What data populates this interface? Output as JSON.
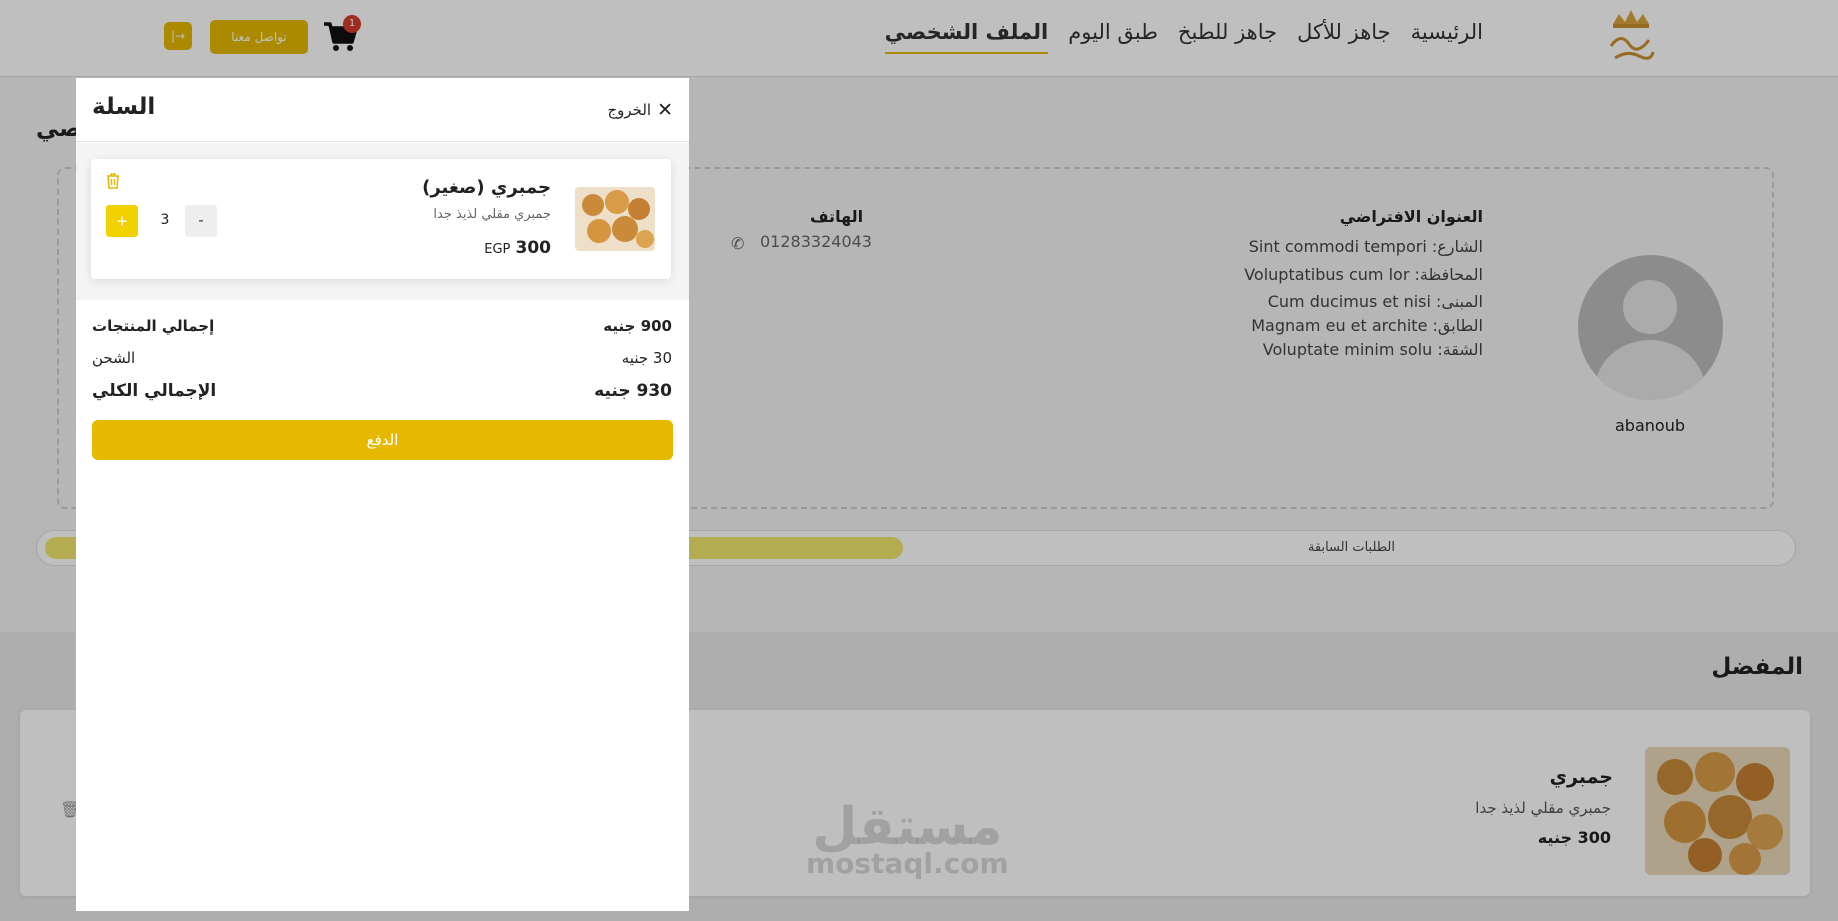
{
  "nav": {
    "links": [
      "الرئيسية",
      "جاهز للأكل",
      "جاهز للطبخ",
      "طبق اليوم",
      "الملف الشخصي"
    ],
    "cart_count": "1",
    "contact_label": "تواصل معنا",
    "login_glyph": "|→"
  },
  "profile": {
    "title": "الملف الشخصي",
    "username": "abanoub",
    "address_title": "العنوان الافتراضي",
    "street": "الشارع: Sint commodi tempori",
    "governorate": "المحافظة: Voluptatibus cum lor",
    "building": "المبنى: Cum ducimus et nisi",
    "floor": "الطابق: Magnam eu et archite",
    "apartment": "الشقة: Voluptate minim solu",
    "phone_title": "الهاتف",
    "phone_value": "01283324043",
    "orders_tab": "الطلبات السابقة"
  },
  "favorites": {
    "title": "المفضل",
    "item": {
      "name": "جمبري",
      "description": "جمبري مقلي لذيذ جدا",
      "price": "300 جنيه"
    }
  },
  "watermark": {
    "ar": "مستقل",
    "en": "mostaql.com"
  },
  "cart": {
    "title": "السلة",
    "close_label": "الخروج",
    "item": {
      "name": "جمبري (صغير)",
      "description": "جمبري مقلي لذيذ جدا",
      "price_value": "300",
      "currency": "EGP",
      "quantity": "3",
      "plus": "+",
      "minus": "-"
    },
    "subtotal_label": "إجمالي المنتجات",
    "subtotal_value": "900 جنيه",
    "shipping_label": "الشحن",
    "shipping_value": "30 جنيه",
    "total_label": "الإجمالي الكلي",
    "total_value": "930 جنيه",
    "pay_label": "الدفع"
  },
  "colors": {
    "accent": "#e6b800",
    "plus_button": "#f2d100",
    "badge": "#d63a2a"
  },
  "icons": [
    "logo-crown-icon",
    "cart-icon",
    "close-icon",
    "trash-icon",
    "phone-icon",
    "user-avatar-icon"
  ]
}
